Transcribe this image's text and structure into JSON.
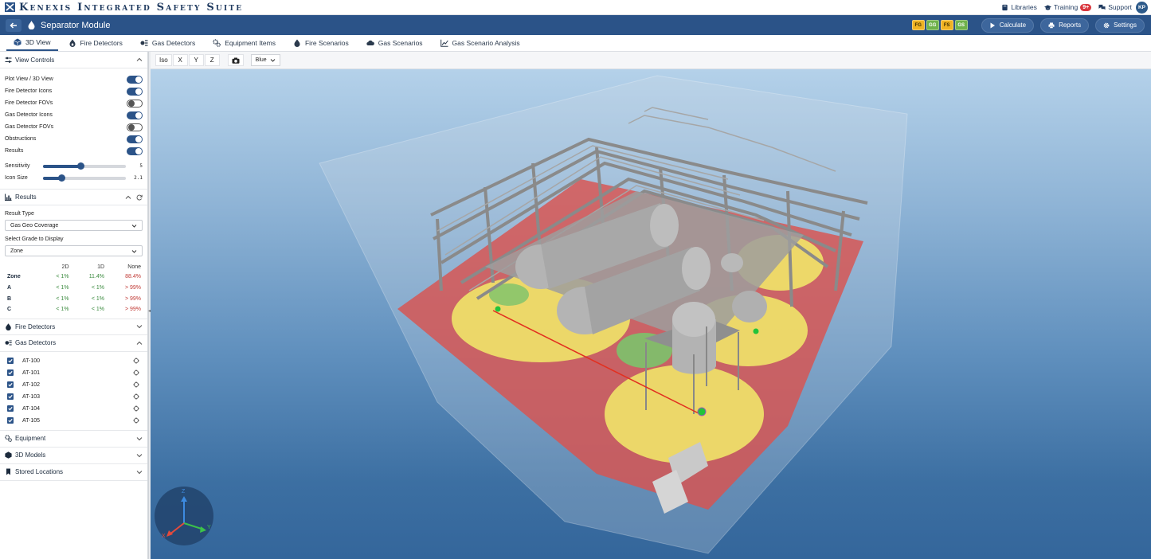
{
  "app": {
    "title": "Kenexis Integrated Safety Suite"
  },
  "topnav": {
    "libraries": "Libraries",
    "training": "Training",
    "training_badge": "9+",
    "support": "Support",
    "user_initials": "KP"
  },
  "module": {
    "title": "Separator Module",
    "badges": [
      {
        "label": "FG",
        "color": "#f0b323",
        "text_color": "#3a2a00"
      },
      {
        "label": "GG",
        "color": "#6fb24b",
        "text_color": "#ffffff"
      },
      {
        "label": "FS",
        "color": "#f0b323",
        "text_color": "#3a2a00"
      },
      {
        "label": "GS",
        "color": "#6fb24b",
        "text_color": "#ffffff"
      }
    ],
    "buttons": {
      "calculate": "Calculate",
      "reports": "Reports",
      "settings": "Settings"
    }
  },
  "tabs": [
    {
      "label": "3D View",
      "active": true
    },
    {
      "label": "Fire Detectors"
    },
    {
      "label": "Gas Detectors"
    },
    {
      "label": "Equipment Items"
    },
    {
      "label": "Fire Scenarios"
    },
    {
      "label": "Gas Scenarios"
    },
    {
      "label": "Gas Scenario Analysis"
    }
  ],
  "view_controls": {
    "title": "View Controls",
    "toggles": [
      {
        "label": "Plot View / 3D View",
        "on": true
      },
      {
        "label": "Fire Detector Icons",
        "on": true
      },
      {
        "label": "Fire Detector FOVs",
        "on": false
      },
      {
        "label": "Gas Detector Icons",
        "on": true
      },
      {
        "label": "Gas Detector FOVs",
        "on": false
      },
      {
        "label": "Obstructions",
        "on": true
      },
      {
        "label": "Results",
        "on": true
      }
    ],
    "sliders": [
      {
        "label": "Sensitivity",
        "value": "5",
        "fraction": 0.45
      },
      {
        "label": "Icon Size",
        "value": "2.1",
        "fraction": 0.22
      }
    ]
  },
  "results": {
    "title": "Results",
    "result_type_label": "Result Type",
    "result_type_value": "Gas Geo Coverage",
    "grade_label": "Select Grade to Display",
    "grade_value": "Zone",
    "columns": [
      "2D",
      "1D",
      "None"
    ],
    "rows": [
      {
        "label": "Zone",
        "values": [
          "< 1%",
          "11.4%",
          "88.4%"
        ]
      },
      {
        "label": "A",
        "values": [
          "< 1%",
          "< 1%",
          "> 99%"
        ]
      },
      {
        "label": "B",
        "values": [
          "< 1%",
          "< 1%",
          "> 99%"
        ]
      },
      {
        "label": "C",
        "values": [
          "< 1%",
          "< 1%",
          "> 99%"
        ]
      }
    ]
  },
  "sections": {
    "fire_detectors": "Fire Detectors",
    "gas_detectors": "Gas Detectors",
    "equipment": "Equipment",
    "models_3d": "3D Models",
    "stored_locations": "Stored Locations"
  },
  "gas_detectors": [
    {
      "id": "AT-100",
      "checked": true
    },
    {
      "id": "AT-101",
      "checked": true
    },
    {
      "id": "AT-102",
      "checked": true
    },
    {
      "id": "AT-103",
      "checked": true
    },
    {
      "id": "AT-104",
      "checked": true
    },
    {
      "id": "AT-105",
      "checked": true
    }
  ],
  "viewport_toolbar": {
    "views": [
      "Iso",
      "X",
      "Y",
      "Z"
    ],
    "color_scheme": "Blue"
  },
  "axes": {
    "x": "X",
    "y": "Y",
    "z": "Z"
  },
  "colors": {
    "primary": "#2b5388",
    "zone_red": "#d9534f",
    "zone_yellow": "#f2ec6a",
    "zone_green": "#7cc36b"
  }
}
